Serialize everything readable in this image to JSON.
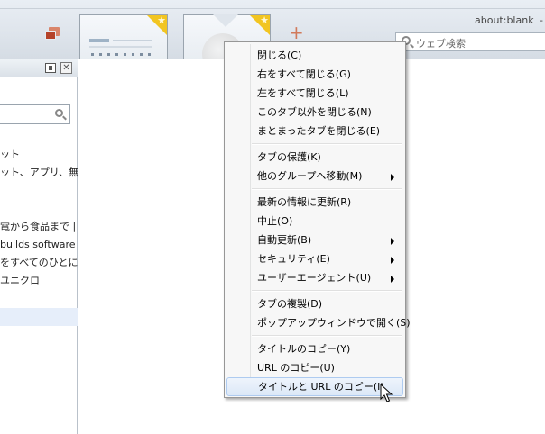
{
  "toolbar": {
    "url_text": "about:blank",
    "url_dash": "-",
    "search_placeholder": "ウェブ検索",
    "new_tab_label": "+",
    "star_glyph": "★"
  },
  "sidebar": {
    "close_glyph": "✕",
    "items": [
      "ット",
      "ット、アプリ、無料の",
      "",
      "電から食品まで |",
      "builds software",
      "をすべてのひとに。",
      "ユニクロ",
      ""
    ]
  },
  "context_menu": {
    "groups": [
      [
        {
          "label": "閉じる(C)"
        },
        {
          "label": "右をすべて閉じる(G)"
        },
        {
          "label": "左をすべて閉じる(L)"
        },
        {
          "label": "このタブ以外を閉じる(N)"
        },
        {
          "label": "まとまったタブを閉じる(E)"
        }
      ],
      [
        {
          "label": "タブの保護(K)"
        },
        {
          "label": "他のグループへ移動(M)",
          "submenu": true
        }
      ],
      [
        {
          "label": "最新の情報に更新(R)"
        },
        {
          "label": "中止(O)"
        },
        {
          "label": "自動更新(B)",
          "submenu": true
        },
        {
          "label": "セキュリティ(E)",
          "submenu": true
        },
        {
          "label": "ユーザーエージェント(U)",
          "submenu": true
        }
      ],
      [
        {
          "label": "タブの複製(D)"
        },
        {
          "label": "ポップアップウィンドウで開く(S)"
        }
      ],
      [
        {
          "label": "タイトルのコピー(Y)"
        },
        {
          "label": "URL のコピー(U)"
        },
        {
          "label": "タイトルと URL のコピー(I)",
          "highlighted": true
        }
      ]
    ]
  }
}
